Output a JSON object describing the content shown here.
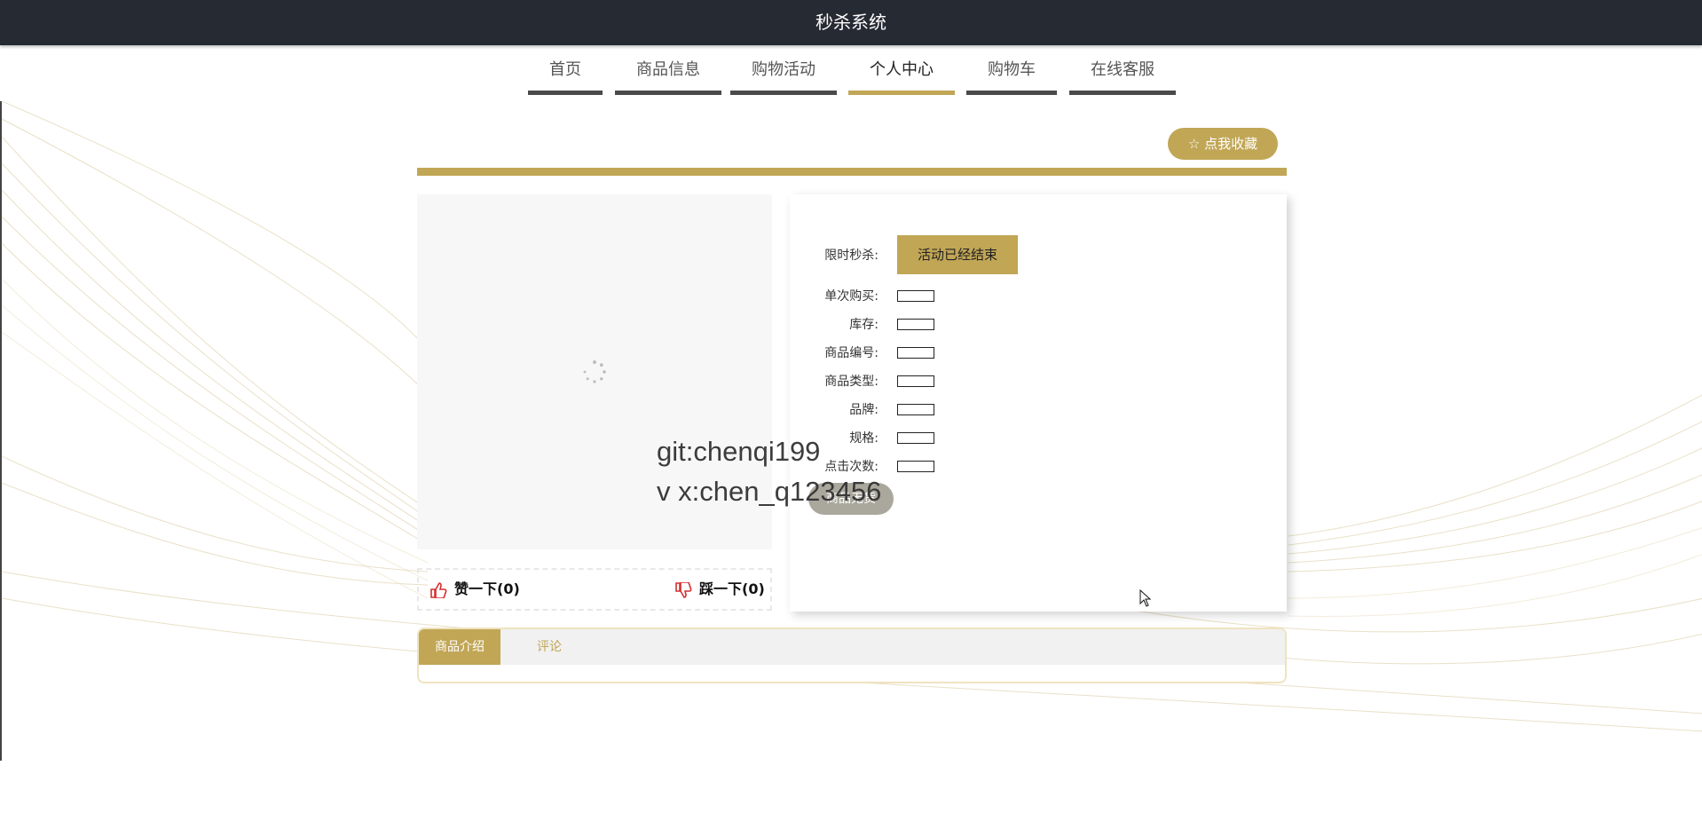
{
  "header": {
    "title": "秒杀系统"
  },
  "nav": {
    "items": [
      {
        "label": "首页"
      },
      {
        "label": "商品信息"
      },
      {
        "label": "购物活动"
      },
      {
        "label": "个人中心"
      },
      {
        "label": "购物车"
      },
      {
        "label": "在线客服"
      }
    ],
    "active_index": 3
  },
  "favorite": {
    "label": "☆ 点我收藏"
  },
  "product": {
    "flash_label": "限时秒杀:",
    "status_label": "活动已经结束",
    "fields": [
      {
        "label": "单次购买:",
        "value": ""
      },
      {
        "label": "库存:",
        "value": ""
      },
      {
        "label": "商品编号:",
        "value": ""
      },
      {
        "label": "商品类型:",
        "value": ""
      },
      {
        "label": "品牌:",
        "value": ""
      },
      {
        "label": "规格:",
        "value": ""
      },
      {
        "label": "点击次数:",
        "value": ""
      }
    ],
    "ghost_button": "商品无货"
  },
  "watermark": {
    "line1": "git:chenqi199",
    "line2": "v x:chen_q123456"
  },
  "votes": {
    "like": "赞一下(0)",
    "dislike": "踩一下(0)"
  },
  "tabs": {
    "items": [
      {
        "label": "商品介绍"
      },
      {
        "label": "评论"
      }
    ],
    "active_index": 0
  },
  "colors": {
    "accent": "#c1a656",
    "topbar": "#262a33",
    "nav_underline": "#4a4a4a"
  }
}
